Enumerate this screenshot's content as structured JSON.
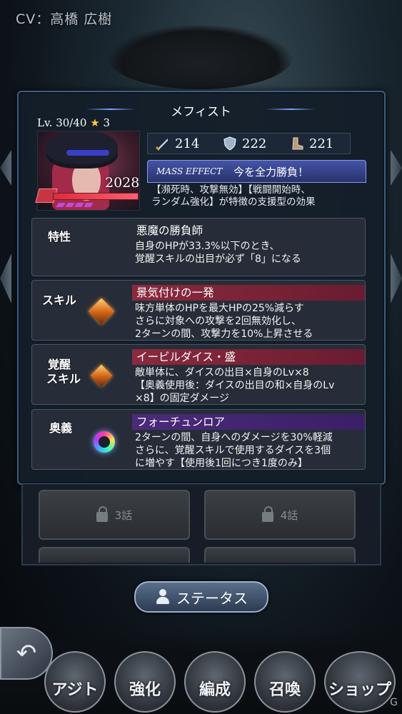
{
  "header": {
    "cv": "CV：高橋 広樹"
  },
  "panel": {
    "title": "メフィスト"
  },
  "character": {
    "level": "Lv. 30/40",
    "star": "★",
    "rarity": "3",
    "hp": "2028",
    "hp_fraction": 1.0
  },
  "stats": {
    "attack": "214",
    "defense": "222",
    "speed": "221"
  },
  "mass_effect": {
    "tag": "MASS EFFECT",
    "title": "今を全力勝負！",
    "desc_line1": "【瀕死時、攻撃無効】【戦闘開始時、",
    "desc_line2": "ランダム強化】が特徴の支援型の効果"
  },
  "trait": {
    "label": "特性",
    "title": "悪魔の勝負師",
    "line1": "自身のHPが33.3%以下のとき、",
    "line2": "覚醒スキルの出目が必ず「8」になる"
  },
  "skill": {
    "label": "スキル",
    "title": "景気付けの一発",
    "line1": "味方単体のHPを最大HPの25%減らす",
    "line2": "さらに対象への攻撃を2回無効化し、",
    "line3": "2ターンの間、攻撃力を10%上昇させる"
  },
  "awaken": {
    "label1": "覚醒",
    "label2": "スキル",
    "title": "イービルダイス・盛",
    "line1": "敵単体に、ダイスの出目×自身のLv×8",
    "line2": "【奥義使用後：ダイスの出目の和×自身のLv",
    "line3": "×8】の固定ダメージ"
  },
  "ultimate": {
    "label": "奥義",
    "title": "フォーチュンロア",
    "line1": "2ターンの間、自身へのダメージを30%軽減",
    "line2": "さらに、覚醒スキルで使用するダイスを3個",
    "line3": "に増やす【使用後1回につき1度のみ】"
  },
  "episodes": {
    "ep3": "3話",
    "ep4": "4話"
  },
  "status_button": "ステータス",
  "nav": {
    "back": "↶",
    "agit": "アジト",
    "enhance": "強化",
    "formation": "編成",
    "summon": "召喚",
    "shop": "ショップ"
  },
  "watermark": "G"
}
